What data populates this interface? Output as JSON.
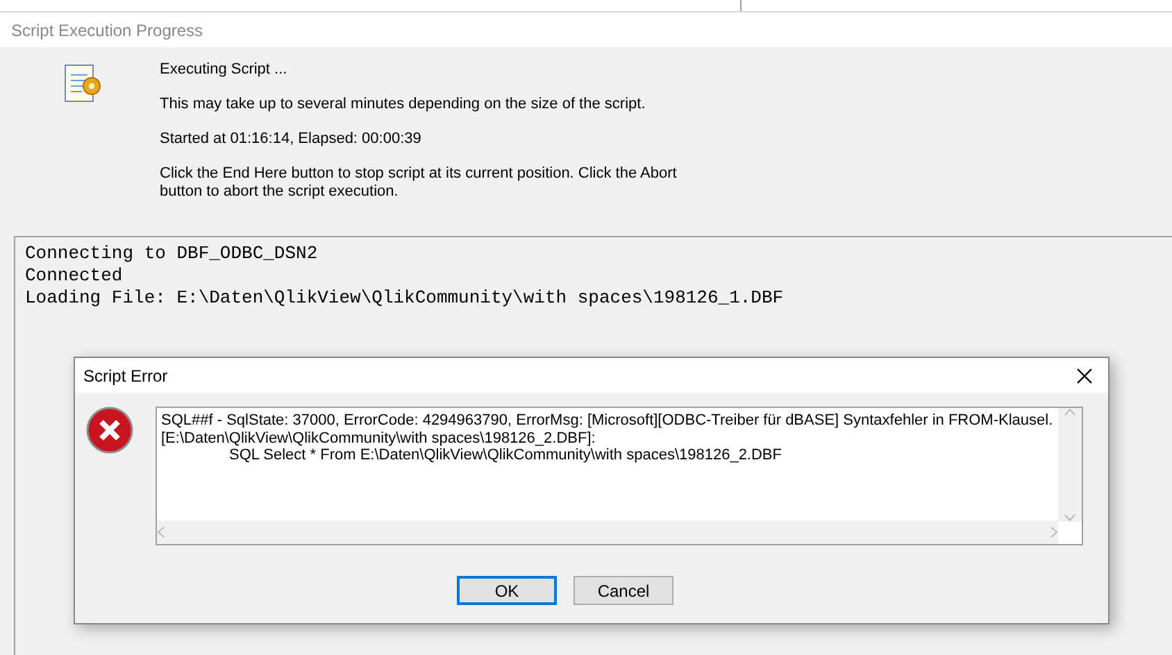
{
  "window": {
    "title": "Script Execution Progress"
  },
  "progress": {
    "lines": [
      "Executing Script ...",
      "This may take up to several minutes depending on the size of the script.",
      "Started at 01:16:14, Elapsed: 00:00:39",
      "Click the End Here button to stop script at its current position. Click the Abort button to abort the script execution."
    ]
  },
  "log": [
    "Connecting to DBF_ODBC_DSN2",
    "Connected",
    "Loading File: E:\\Daten\\QlikView\\QlikCommunity\\with spaces\\198126_1.DBF"
  ],
  "error_dialog": {
    "title": "Script Error",
    "message": [
      {
        "text": "SQL##f - SqlState: 37000, ErrorCode: 4294963790, ErrorMsg: [Microsoft][ODBC-Treiber für dBASE] Syntaxfehler in FROM-Klausel.",
        "indented": false
      },
      {
        "text": "[E:\\Daten\\QlikView\\QlikCommunity\\with spaces\\198126_2.DBF]:",
        "indented": false
      },
      {
        "text": "SQL Select * From E:\\Daten\\QlikView\\QlikCommunity\\with spaces\\198126_2.DBF",
        "indented": true
      }
    ],
    "buttons": [
      {
        "label": "OK",
        "focused": true
      },
      {
        "label": "Cancel",
        "focused": false
      }
    ]
  }
}
